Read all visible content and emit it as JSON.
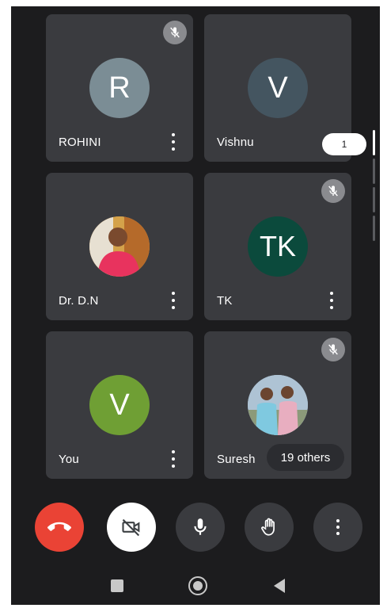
{
  "participants": [
    {
      "name": "ROHINI",
      "initial": "R",
      "avatar_color": "#7b8d95",
      "muted": true
    },
    {
      "name": "Vishnu",
      "initial": "V",
      "avatar_color": "#445560",
      "muted": false
    },
    {
      "name": "Dr. D.N",
      "initial": "",
      "avatar_color": "#c07838",
      "muted": false
    },
    {
      "name": "TK",
      "initial": "TK",
      "avatar_color": "#0b4a3c",
      "muted": true
    },
    {
      "name": "You",
      "initial": "V",
      "avatar_color": "#6f9f34",
      "muted": false
    },
    {
      "name": "Suresh",
      "initial": "",
      "avatar_color": "#9bb4c8",
      "muted": true
    }
  ],
  "page_badge": "1",
  "others_chip": "19 others",
  "controls": {
    "end_call_color": "#ea4335",
    "icons": [
      "end-call-icon",
      "camera-off-icon",
      "microphone-icon",
      "raise-hand-icon",
      "more-options-icon"
    ]
  },
  "system_nav": [
    "recent-apps-icon",
    "home-icon",
    "back-icon"
  ]
}
